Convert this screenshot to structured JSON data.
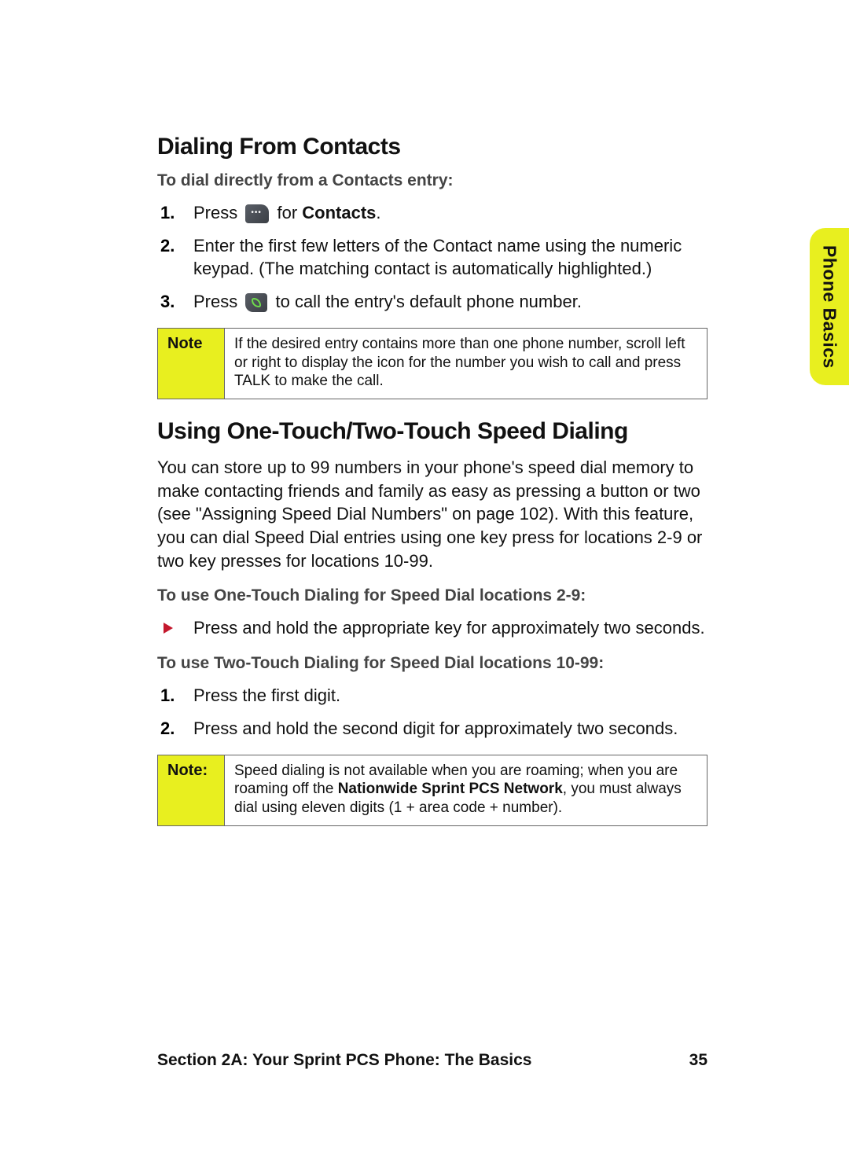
{
  "sideTab": "Phone Basics",
  "section1": {
    "title": "Dialing From Contacts",
    "instr": "To dial directly from a Contacts entry:",
    "steps": {
      "s1a": "Press ",
      "s1b": " for ",
      "s1c": "Contacts",
      "s1d": ".",
      "s2": "Enter the first few letters of the Contact name using the numeric keypad. (The matching contact is automatically highlighted.)",
      "s3a": "Press ",
      "s3b": " to call the entry's default phone number."
    },
    "noteLabel": "Note",
    "noteBody": "If the desired entry contains more than one phone number, scroll left or right to display the icon for the number you wish to call and press TALK to make the call."
  },
  "section2": {
    "title": "Using One-Touch/Two-Touch Speed Dialing",
    "intro": "You can store up to 99 numbers in your phone's speed dial memory to make contacting friends and family as easy as pressing a button or two (see \"Assigning Speed Dial Numbers\" on page 102). With this feature, you can dial Speed Dial entries using one key press for locations 2-9 or two key presses for locations 10-99.",
    "instrA": "To use One-Touch Dialing for Speed Dial locations 2-9:",
    "bulletA": "Press and hold the appropriate key for approximately two seconds.",
    "instrB": "To use Two-Touch Dialing for Speed Dial locations 10-99:",
    "stepsB": {
      "s1": "Press the first digit.",
      "s2": "Press and hold the second digit for approximately two seconds."
    },
    "noteLabel": "Note:",
    "noteBodyA": "Speed dialing is not available when you are roaming; when you are roaming off the ",
    "noteBodyBold": "Nationwide Sprint PCS Network",
    "noteBodyB": ", you must always dial using eleven digits (1 + area code + number)."
  },
  "footer": {
    "left": "Section 2A: Your Sprint PCS Phone: The Basics",
    "right": "35"
  }
}
